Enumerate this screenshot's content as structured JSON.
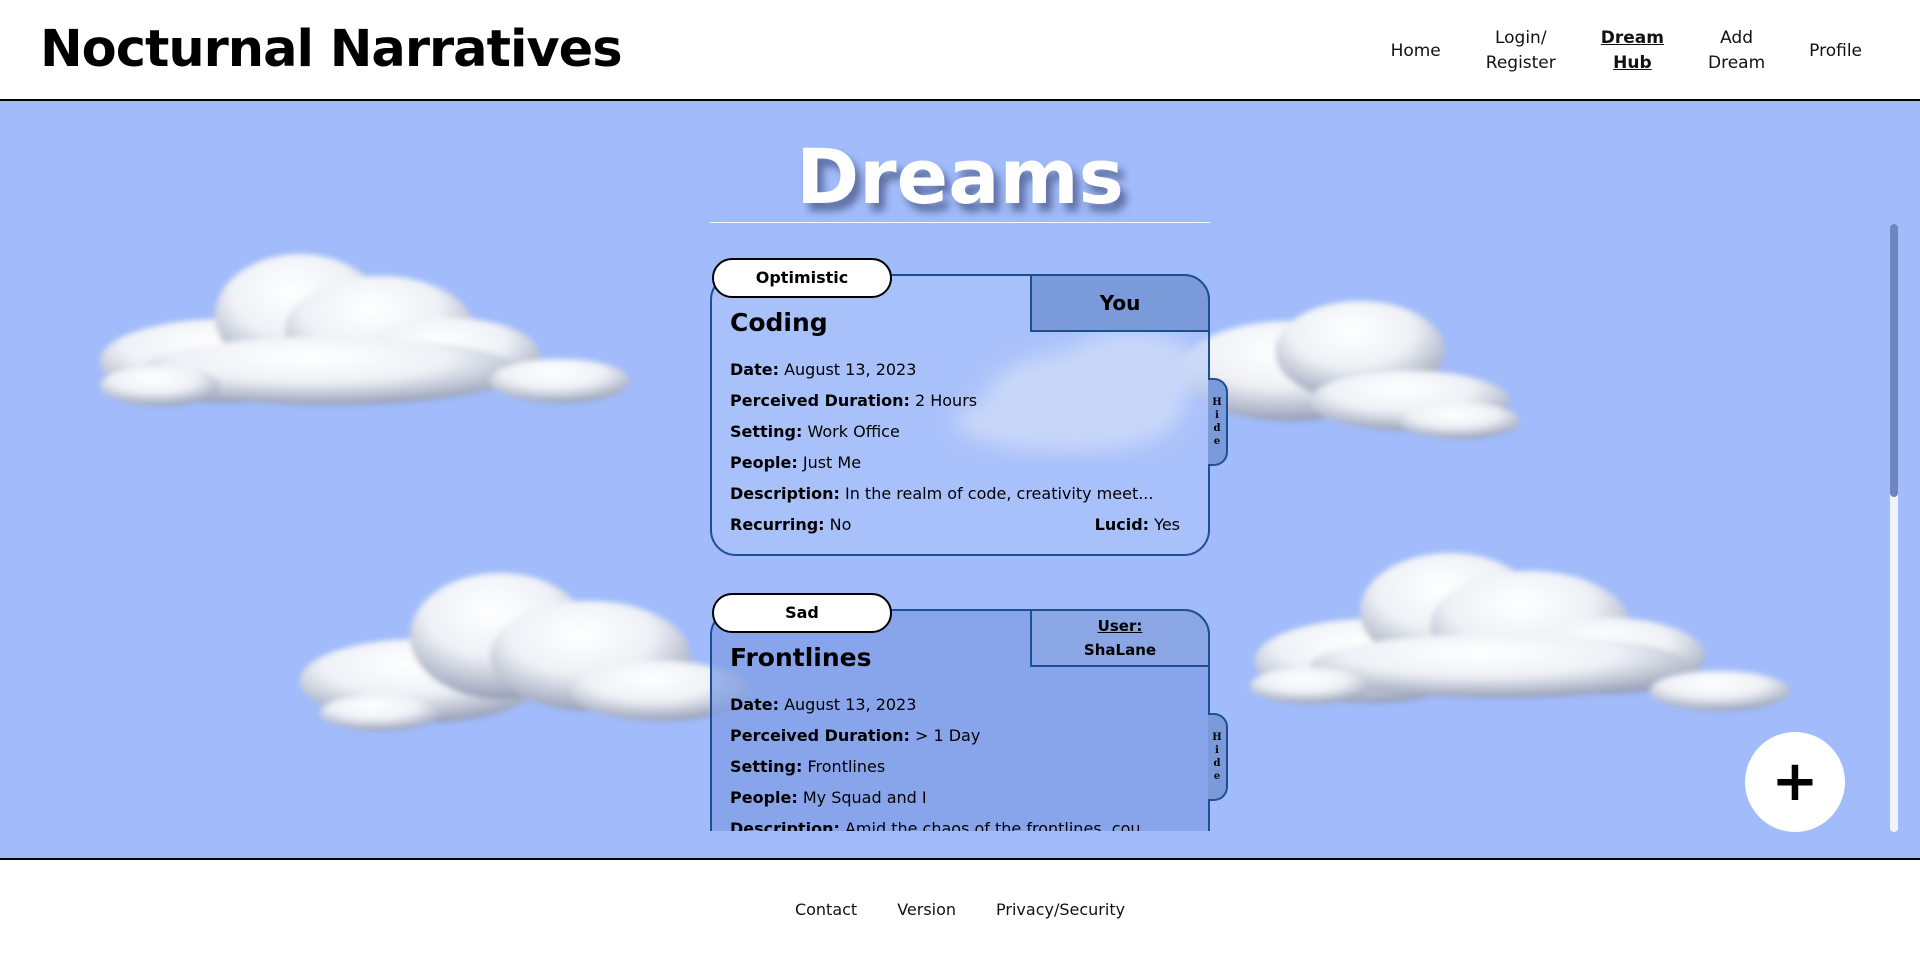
{
  "brand": "Nocturnal Narratives",
  "nav": {
    "home": "Home",
    "login_line1": "Login/",
    "login_line2": "Register",
    "hub_line1": "Dream",
    "hub_line2": "Hub",
    "add_line1": "Add",
    "add_line2": "Dream",
    "profile": "Profile"
  },
  "page": {
    "heading": "Dreams",
    "fab_symbol": "+"
  },
  "labels": {
    "date": "Date:",
    "duration": "Perceived Duration:",
    "setting": "Setting:",
    "people": "People:",
    "description": "Description:",
    "recurring": "Recurring:",
    "lucid": "Lucid:",
    "hide": [
      "H",
      "i",
      "d",
      "e"
    ]
  },
  "dreams": [
    {
      "mood": "Optimistic",
      "owner": "You",
      "title": "Coding",
      "date": "August 13, 2023",
      "duration": "2 Hours",
      "setting": "Work Office",
      "people": "Just Me",
      "description": "In the realm of code, creativity meet...",
      "recurring": "No",
      "lucid": "Yes"
    },
    {
      "mood": "Sad",
      "owner_label": "User:",
      "owner": "ShaLane",
      "title": "Frontlines",
      "date": "August 13, 2023",
      "duration": "> 1 Day",
      "setting": "Frontlines",
      "people": "My Squad and I",
      "description": "Amid the chaos of the frontlines, cou..."
    }
  ],
  "footer": {
    "contact": "Contact",
    "version": "Version",
    "privacy": "Privacy/Security"
  },
  "colors": {
    "background": "#a1bbfb",
    "card_border": "#1d4f91",
    "owner_tab": "#7b9ad9",
    "scroll_thumb": "#6f85be"
  }
}
